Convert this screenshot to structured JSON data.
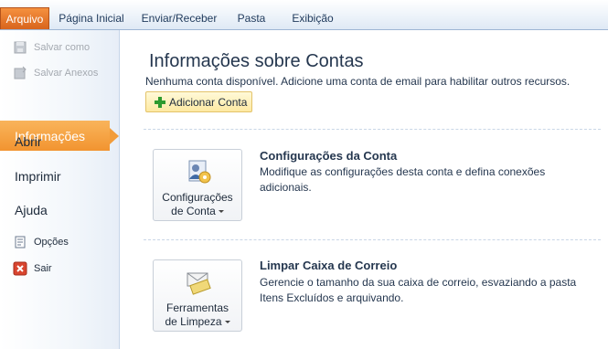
{
  "ribbon": {
    "file_tab": "Arquivo",
    "tabs": [
      "Página Inicial",
      "Enviar/Receber",
      "Pasta",
      "Exibição"
    ]
  },
  "nav": {
    "save_as": "Salvar como",
    "save_attachments": "Salvar Anexos",
    "info": "Informações",
    "open": "Abrir",
    "print": "Imprimir",
    "help": "Ajuda",
    "options": "Opções",
    "exit": "Sair"
  },
  "main": {
    "title": "Informações sobre Contas",
    "subtitle": "Nenhuma conta disponível. Adicione uma conta de email para habilitar outros recursos.",
    "add_account": "Adicionar Conta",
    "account_settings": {
      "button_line1": "Configurações",
      "button_line2": "de Conta",
      "title": "Configurações da Conta",
      "description": "Modifique as configurações desta conta e defina conexões adicionais."
    },
    "cleanup": {
      "button_line1": "Ferramentas",
      "button_line2": "de Limpeza",
      "title": "Limpar Caixa de Correio",
      "description": "Gerencie o tamanho da sua caixa de correio, esvaziando a pasta Itens Excluídos e arquivando."
    }
  },
  "colors": {
    "file_tab": "#e77a2a",
    "selected_nav": "#f5a33f",
    "text": "#25374f"
  }
}
